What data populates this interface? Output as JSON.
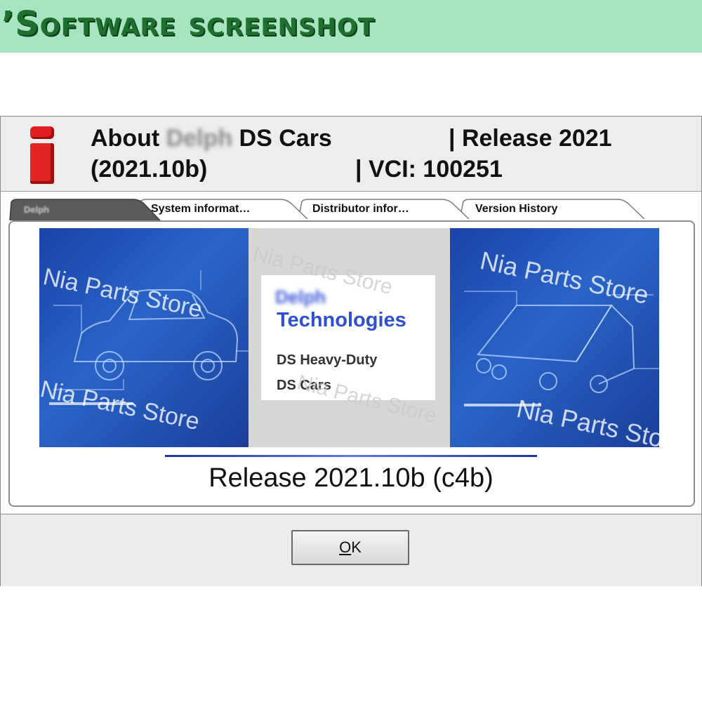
{
  "banner": {
    "title": "’Software screenshot"
  },
  "dialog": {
    "title_about": "About",
    "title_blurred_brand": "Delph",
    "title_product": "DS Cars",
    "title_release": "| Release 2021",
    "title_version": "(2021.10b)",
    "title_vci": "|  VCI: 100251"
  },
  "tabs": [
    {
      "label": "Delph",
      "active": true
    },
    {
      "label": "System  informat…",
      "active": false
    },
    {
      "label": "Distributor  infor…",
      "active": false
    },
    {
      "label": "Version History",
      "active": false
    }
  ],
  "logo": {
    "blurred_brand": "Delph",
    "company": "Technologies",
    "products": [
      "DS Heavy-Duty",
      "DS Cars"
    ]
  },
  "watermark": "Nia Parts Store",
  "release_text": "Release 2021.10b (c4b)",
  "ok_button": {
    "label_first": "O",
    "label_rest": "K"
  },
  "colors": {
    "banner_bg": "#a8e4c0",
    "banner_text": "#1f6f2e",
    "info_icon": "#e22424",
    "image_blue": "#2a64c8",
    "logo_blue": "#2e4fd0"
  }
}
